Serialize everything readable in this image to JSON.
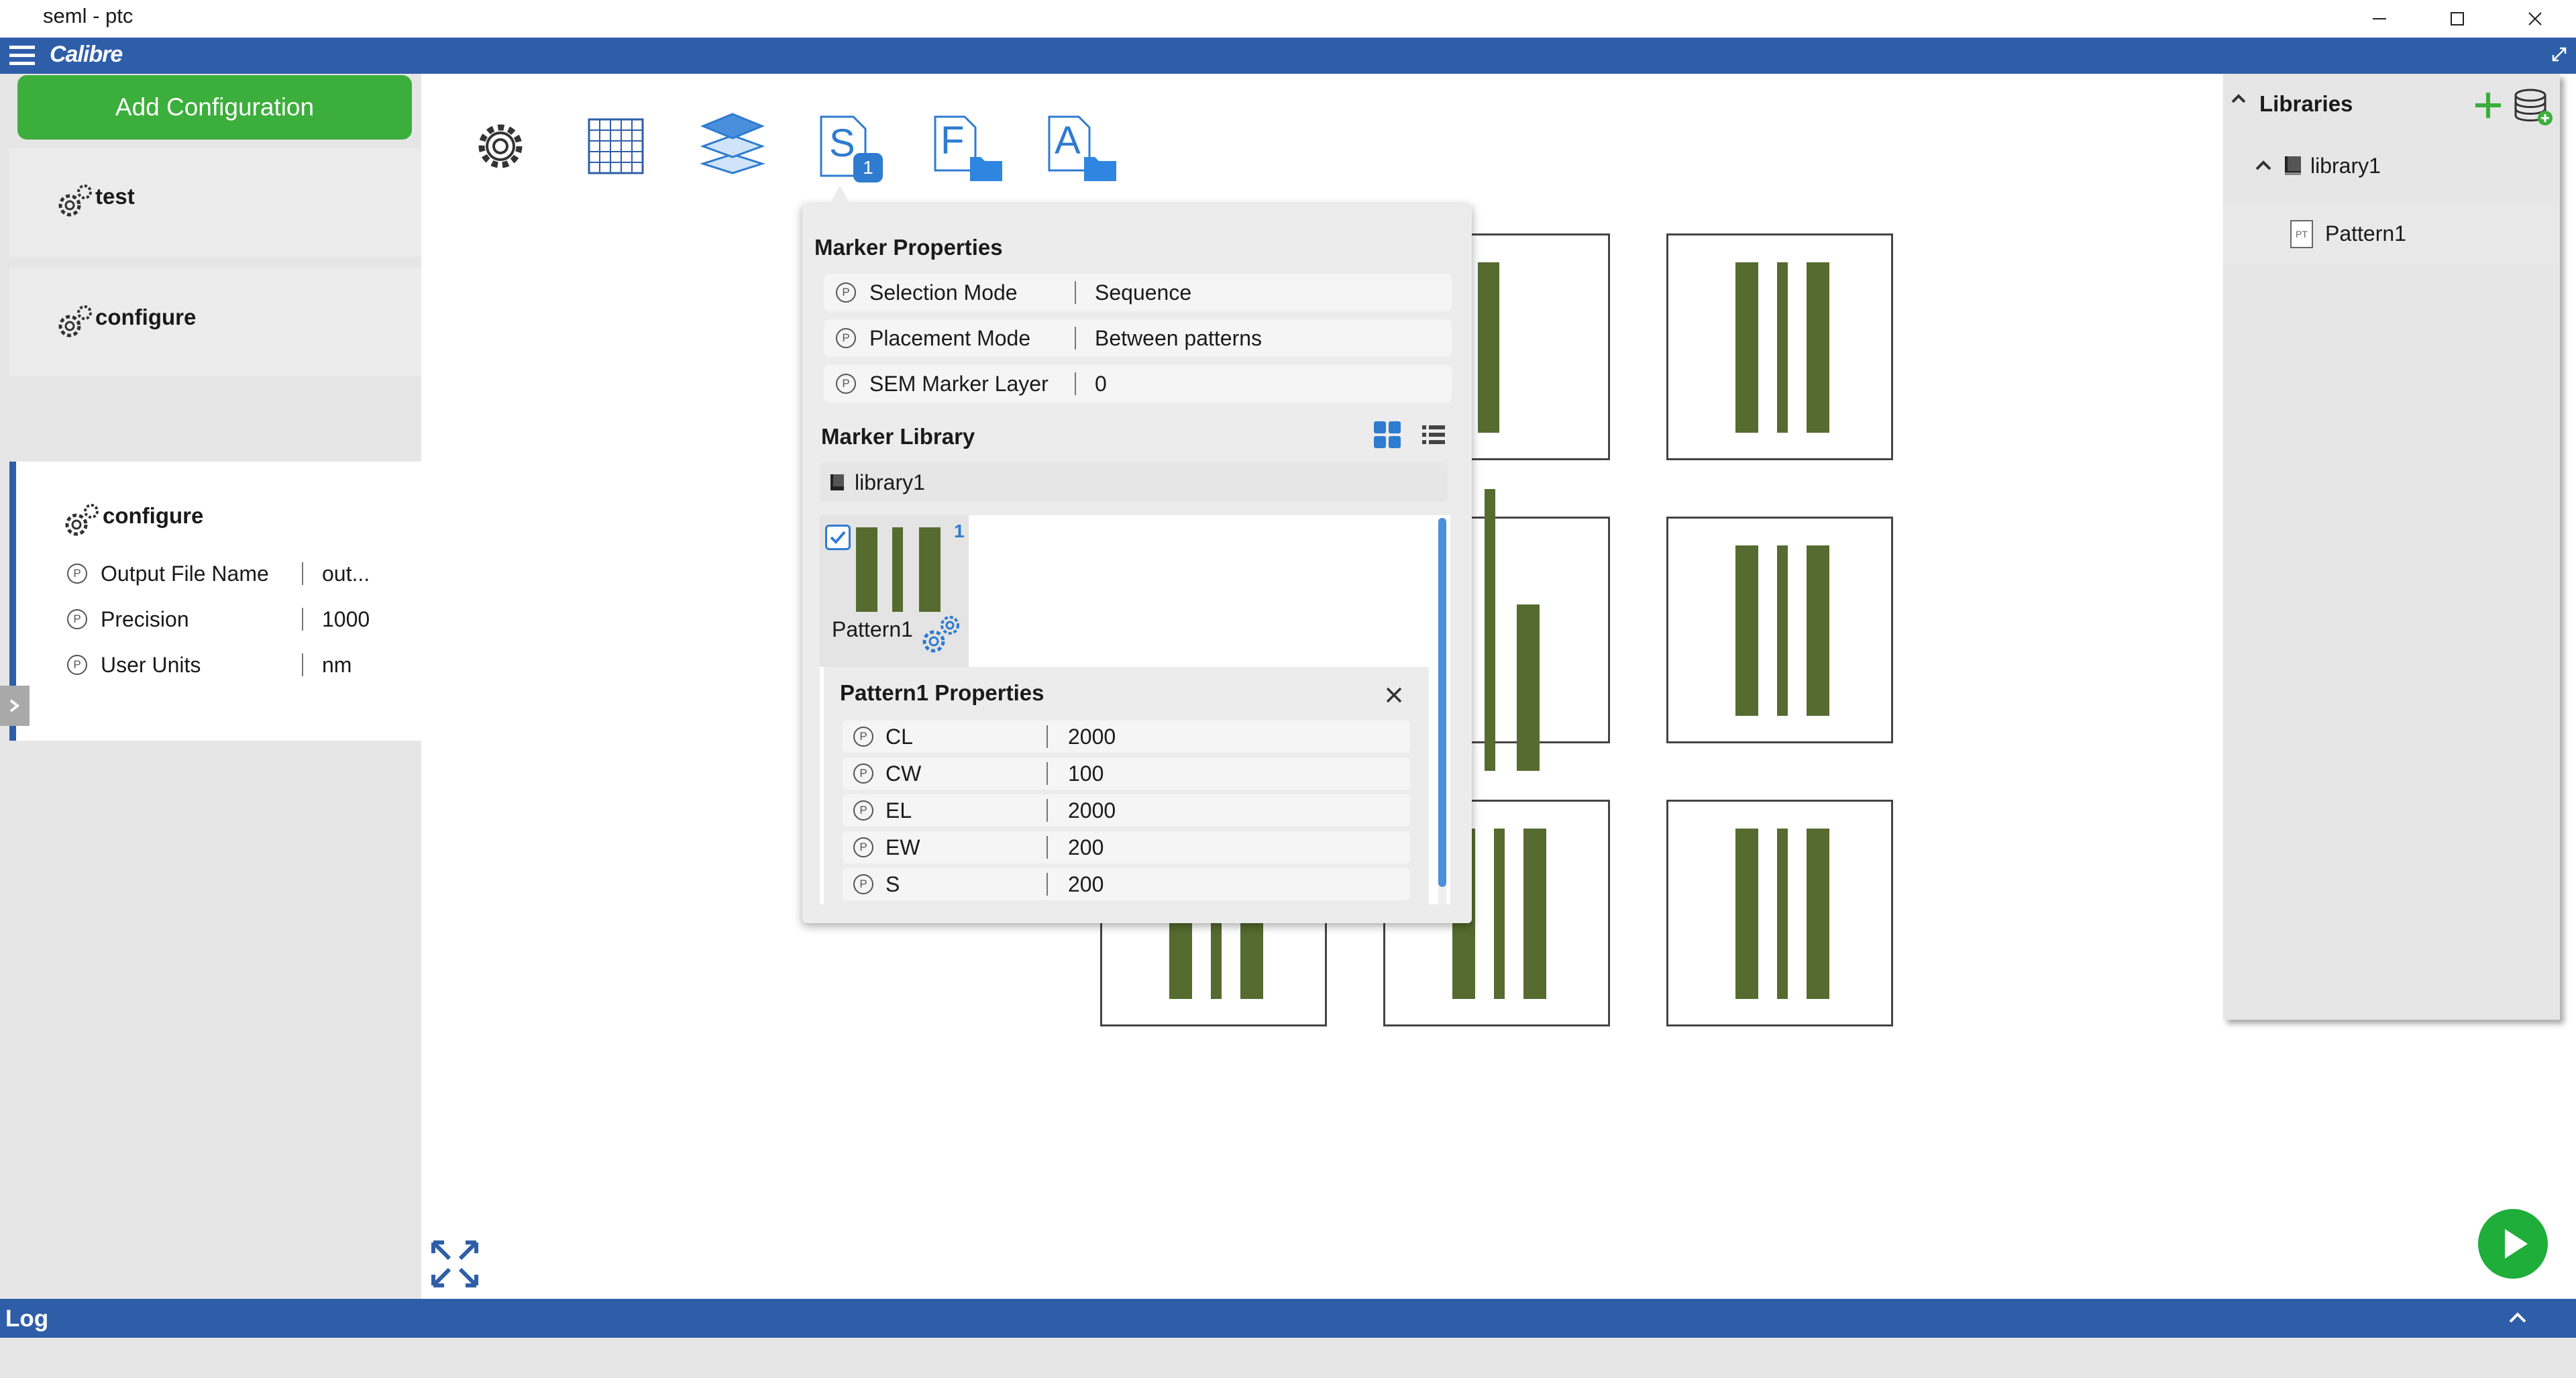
{
  "window": {
    "title": "seml - ptc"
  },
  "appbar": {
    "brand": "Calibre"
  },
  "left": {
    "add_configuration_label": "Add Configuration",
    "configs": [
      {
        "name": "test"
      },
      {
        "name": "configure"
      }
    ],
    "active": {
      "name": "configure",
      "props": [
        {
          "badge": "P",
          "label": "Output File Name",
          "value": "out..."
        },
        {
          "badge": "P",
          "label": "Precision",
          "value": "1000"
        },
        {
          "badge": "P",
          "label": "User Units",
          "value": "nm"
        }
      ]
    }
  },
  "toolbar": {
    "sequence_letter": "S",
    "sequence_badge": "1",
    "file_letter": "F",
    "attr_letter": "A"
  },
  "popup": {
    "marker_properties_title": "Marker Properties",
    "marker_props": [
      {
        "badge": "P",
        "label": "Selection Mode",
        "value": "Sequence"
      },
      {
        "badge": "P",
        "label": "Placement Mode",
        "value": "Between patterns"
      },
      {
        "badge": "P",
        "label": "SEM Marker Layer",
        "value": "0"
      }
    ],
    "marker_library_title": "Marker Library",
    "library_name": "library1",
    "pattern_card": {
      "name": "Pattern1",
      "count": "1"
    },
    "pattern_props_title": "Pattern1 Properties",
    "pattern_props": [
      {
        "badge": "P",
        "label": "CL",
        "value": "2000"
      },
      {
        "badge": "P",
        "label": "CW",
        "value": "100"
      },
      {
        "badge": "P",
        "label": "EL",
        "value": "2000"
      },
      {
        "badge": "P",
        "label": "EW",
        "value": "200"
      },
      {
        "badge": "P",
        "label": "S",
        "value": "200"
      }
    ]
  },
  "libraries": {
    "title": "Libraries",
    "tree": {
      "library": "library1",
      "pattern_badge": "PT",
      "pattern": "Pattern1"
    }
  },
  "log": {
    "title": "Log"
  },
  "colors": {
    "accent": "#2f5ea8",
    "add_button": "#3cae3c",
    "pattern_bar": "#556b2f",
    "run_button": "#1fae3a"
  }
}
